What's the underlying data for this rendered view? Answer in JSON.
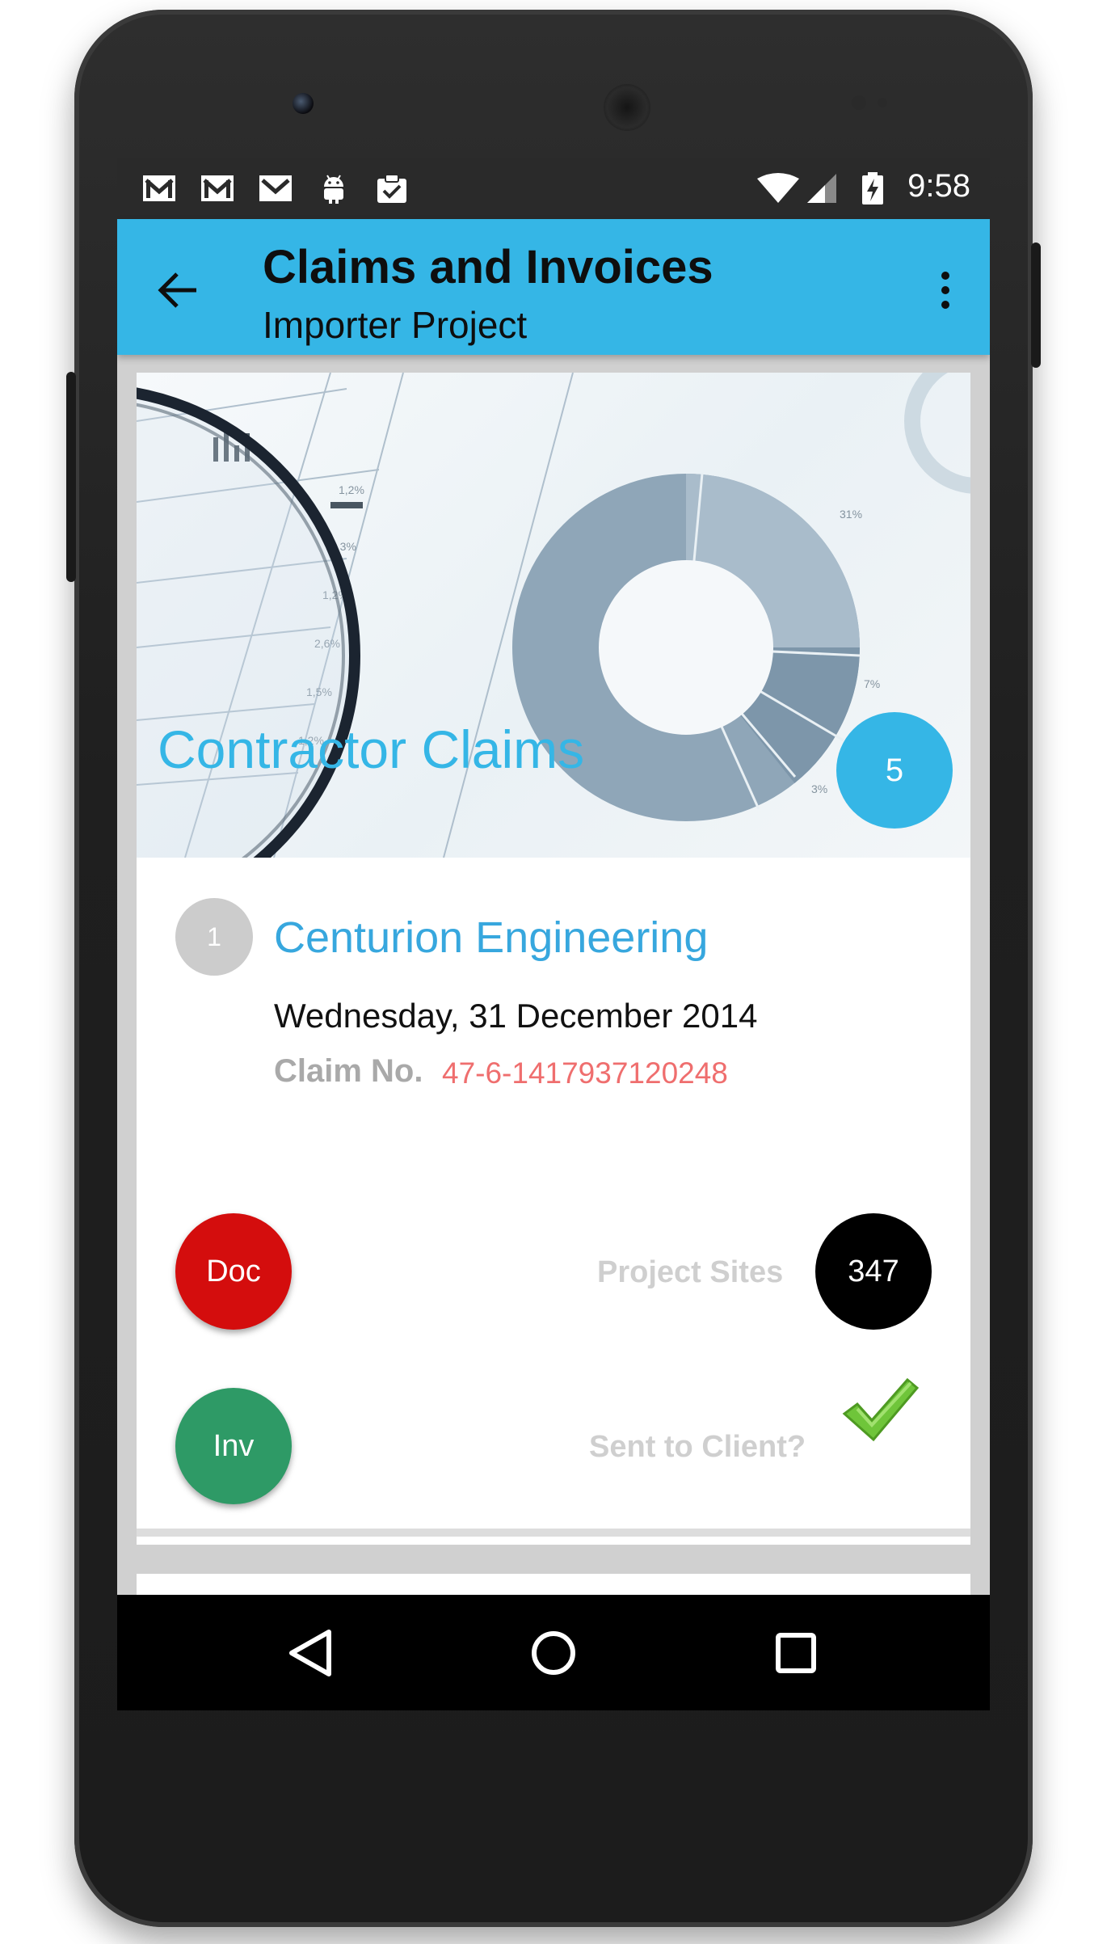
{
  "status_bar": {
    "time": "9:58",
    "left_icons": [
      "gmail-icon",
      "gmail-icon",
      "gmail-icon",
      "android-icon",
      "clipboard-check-icon"
    ],
    "right_icons": [
      "wifi-icon",
      "signal-icon",
      "battery-charging-icon"
    ]
  },
  "app_bar": {
    "title": "Claims and Invoices",
    "subtitle": "Importer Project",
    "back_icon": "arrow-back-icon",
    "menu_icon": "more-vert-icon"
  },
  "hero": {
    "title": "Contractor Claims",
    "count": "5"
  },
  "claim": {
    "index": "1",
    "company": "Centurion Engineering",
    "date": "Wednesday, 31 December 2014",
    "claim_label": "Claim No.",
    "claim_number": "47-6-1417937120248",
    "doc_button": "Doc",
    "inv_button": "Inv",
    "project_sites_label": "Project Sites",
    "project_sites_count": "347",
    "sent_to_client_label": "Sent to Client?",
    "sent_to_client": true
  },
  "nav_bar": {
    "icons": [
      "back-triangle-icon",
      "home-circle-icon",
      "recents-square-icon"
    ]
  },
  "colors": {
    "accent": "#35b6e6",
    "doc": "#d40d0d",
    "inv": "#2e9a66",
    "claim_number": "#ef6e6e",
    "check": "#6fc53a"
  }
}
